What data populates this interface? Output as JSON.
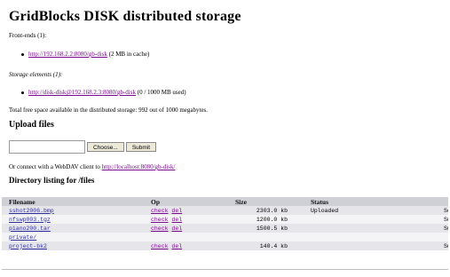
{
  "page": {
    "title": "GridBlocks DISK distributed storage",
    "front_ends_label": "Front-ends (1):",
    "front_end": {
      "link": "http://192.168.2.2:8080/gb-disk",
      "note": "(2 MB in cache)"
    },
    "storage_label": "Storage elements (1):",
    "storage": {
      "link": "http://disk-disk@192.168.2.3:8080/gb-disk",
      "note": "(0 / 1000 MB used)"
    },
    "total_free": "Total free space available in the distributed storage: 992 out of 1000 megabytes.",
    "upload_heading": "Upload files",
    "file_input_value": "",
    "choose_label": "Choose...",
    "submit_label": "Submit",
    "webdav_text": "Or connect with a WebDAV client to ",
    "webdav_link": "http://localhost:8080/gb-disk/",
    "dir_heading": "Directory listing for /files"
  },
  "table": {
    "headers": [
      "Filename",
      "Op",
      "Size",
      "Status",
      ""
    ],
    "rows": [
      {
        "name": "sshot2006.bmp",
        "op1": "check",
        "op2": "del",
        "size": "2303.0 kb",
        "status": "Uploaded",
        "extra": "So"
      },
      {
        "name": "nfswp003.tgz",
        "op1": "check",
        "op2": "del",
        "size": "1200.0 kb",
        "status": "",
        "extra": "Su"
      },
      {
        "name": "piano200.tar",
        "op1": "check",
        "op2": "del",
        "size": "1500.5 kb",
        "status": "",
        "extra": "Su"
      },
      {
        "name": "private/",
        "op1": "",
        "op2": "",
        "size": "",
        "status": "",
        "extra": ""
      },
      {
        "name": "project-bk2",
        "op1": "check",
        "op2": "del",
        "size": "140.4 kb",
        "status": "",
        "extra": "Su"
      }
    ]
  }
}
